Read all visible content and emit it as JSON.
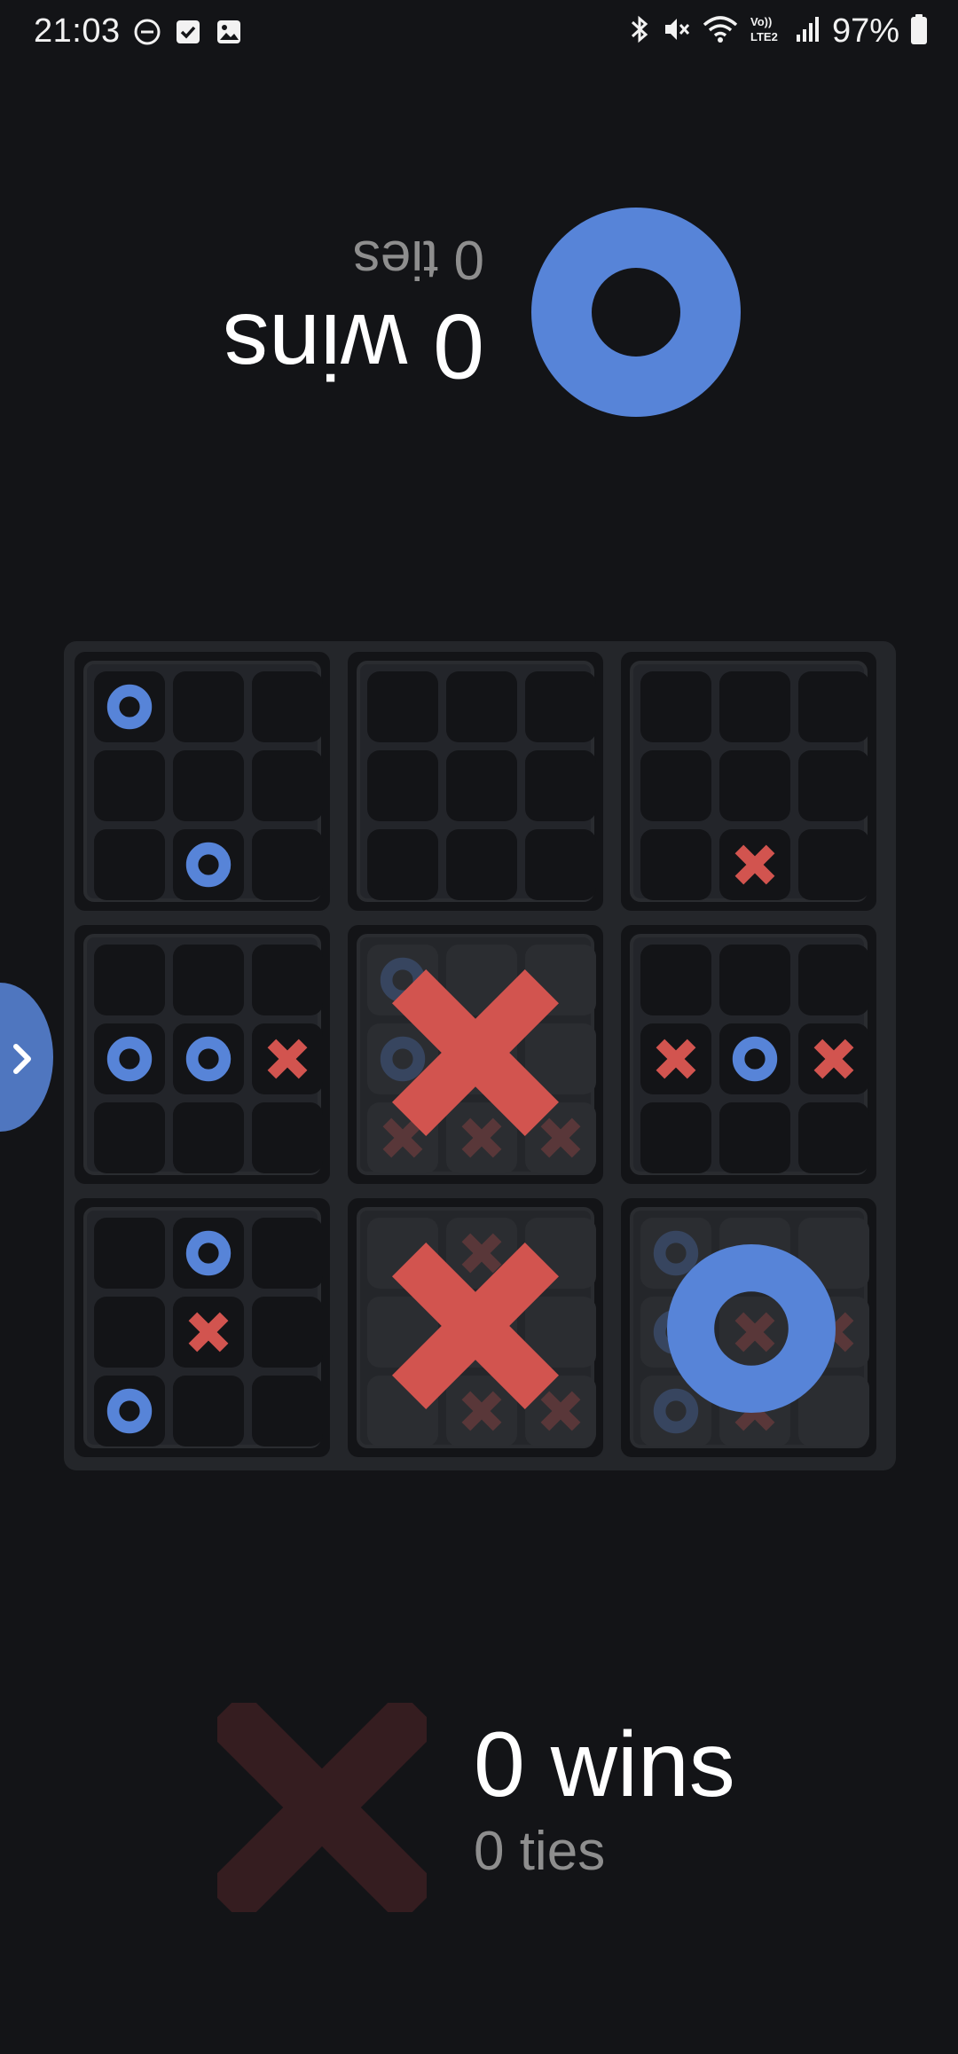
{
  "status_bar": {
    "time": "21:03",
    "battery_percent": "97%",
    "network_label": "Vo)) LTE2",
    "left_icons": [
      "do-not-disturb-icon",
      "checkbox-icon",
      "image-icon"
    ],
    "right_icons": [
      "bluetooth-icon",
      "mute-icon",
      "wifi-icon",
      "volte-icon",
      "signal-icon",
      "battery-icon"
    ]
  },
  "colors": {
    "background": "#131417",
    "player_o": "#5784d8",
    "player_x": "#d2544f",
    "player_x_inactive": "#351d20",
    "board": "#24262a"
  },
  "player_o": {
    "symbol": "O",
    "wins_label": "0 wins",
    "ties_label": "0 ties",
    "orientation": "upside-down"
  },
  "player_x": {
    "symbol": "X",
    "wins_label": "0 wins",
    "ties_label": "0 ties",
    "active": false
  },
  "board": {
    "subboards": [
      {
        "winner": null,
        "cells": [
          "O",
          "",
          "",
          "",
          "",
          "",
          "",
          "O",
          ""
        ]
      },
      {
        "winner": null,
        "cells": [
          "",
          "",
          "",
          "",
          "",
          "",
          "",
          "",
          ""
        ]
      },
      {
        "winner": null,
        "cells": [
          "",
          "",
          "",
          "",
          "",
          "",
          "",
          "X",
          ""
        ]
      },
      {
        "winner": null,
        "cells": [
          "",
          "",
          "",
          "O",
          "O",
          "X",
          "",
          "",
          ""
        ]
      },
      {
        "winner": "X",
        "cells": [
          "O",
          "",
          "",
          "O",
          "",
          "",
          "X",
          "X",
          "X"
        ]
      },
      {
        "winner": null,
        "cells": [
          "",
          "",
          "",
          "X",
          "O",
          "X",
          "",
          "",
          ""
        ]
      },
      {
        "winner": null,
        "cells": [
          "",
          "O",
          "",
          "",
          "X",
          "",
          "O",
          "",
          ""
        ]
      },
      {
        "winner": "X",
        "cells": [
          "",
          "X",
          "",
          "",
          "",
          "",
          "",
          "X",
          "X"
        ]
      },
      {
        "winner": "O",
        "cells": [
          "O",
          "",
          "",
          "O",
          "X",
          "X",
          "O",
          "X",
          ""
        ]
      }
    ]
  },
  "side_tab": {
    "icon": "chevron-right-icon"
  }
}
